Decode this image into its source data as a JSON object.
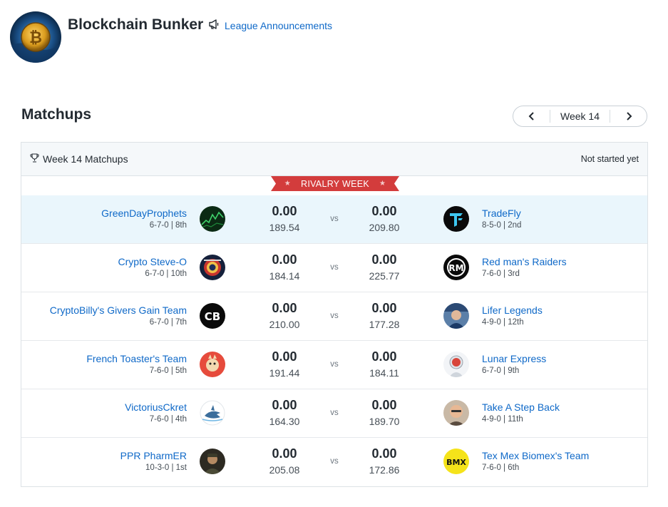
{
  "league": {
    "name": "Blockchain Bunker",
    "announcements_label": "League Announcements"
  },
  "section": {
    "title": "Matchups"
  },
  "week_nav": {
    "label": "Week 14"
  },
  "panel": {
    "title": "Week 14 Matchups",
    "status": "Not started yet",
    "banner": "RIVALRY WEEK"
  },
  "colors": {
    "link": "#0f69c8",
    "banner": "#d33c3c",
    "highlight_row": "#eaf6fc"
  },
  "matchups": [
    {
      "vs": "vs",
      "left": {
        "name": "GreenDayProphets",
        "record": "6-7-0 | 8th",
        "points": "0.00",
        "projected": "189.54",
        "avatar": "green-chart-avatar"
      },
      "right": {
        "name": "TradeFly",
        "record": "8-5-0 | 2nd",
        "points": "0.00",
        "projected": "209.80",
        "avatar": "tradefly-logo-avatar"
      }
    },
    {
      "vs": "vs",
      "left": {
        "name": "Crypto Steve-O",
        "record": "6-7-0 | 10th",
        "points": "0.00",
        "projected": "184.14",
        "avatar": "badge-avatar"
      },
      "right": {
        "name": "Red man's Raiders",
        "record": "7-6-0 | 3rd",
        "points": "0.00",
        "projected": "225.77",
        "avatar": "rm-logo-avatar"
      }
    },
    {
      "vs": "vs",
      "left": {
        "name": "CryptoBilly's Givers Gain Team",
        "record": "6-7-0 | 7th",
        "points": "0.00",
        "projected": "210.00",
        "avatar": "cb-logo-avatar"
      },
      "right": {
        "name": "Lifer Legends",
        "record": "4-9-0 | 12th",
        "points": "0.00",
        "projected": "177.28",
        "avatar": "photo-avatar"
      }
    },
    {
      "vs": "vs",
      "left": {
        "name": "French Toaster's Team",
        "record": "7-6-0 | 5th",
        "points": "0.00",
        "projected": "191.44",
        "avatar": "cartoon-avatar"
      },
      "right": {
        "name": "Lunar Express",
        "record": "6-7-0 | 9th",
        "points": "0.00",
        "projected": "184.11",
        "avatar": "astronaut-avatar"
      }
    },
    {
      "vs": "vs",
      "left": {
        "name": "VictoriusCkret",
        "record": "7-6-0 | 4th",
        "points": "0.00",
        "projected": "164.30",
        "avatar": "shark-avatar"
      },
      "right": {
        "name": "Take A Step Back",
        "record": "4-9-0 | 11th",
        "points": "0.00",
        "projected": "189.70",
        "avatar": "face-photo-avatar"
      }
    },
    {
      "vs": "vs",
      "left": {
        "name": "PPR PharmER",
        "record": "10-3-0 | 1st",
        "points": "0.00",
        "projected": "205.08",
        "avatar": "portrait-avatar"
      },
      "right": {
        "name": "Tex Mex Biomex's Team",
        "record": "7-6-0 | 6th",
        "points": "0.00",
        "projected": "172.86",
        "avatar": "bmx-logo-avatar"
      }
    }
  ]
}
